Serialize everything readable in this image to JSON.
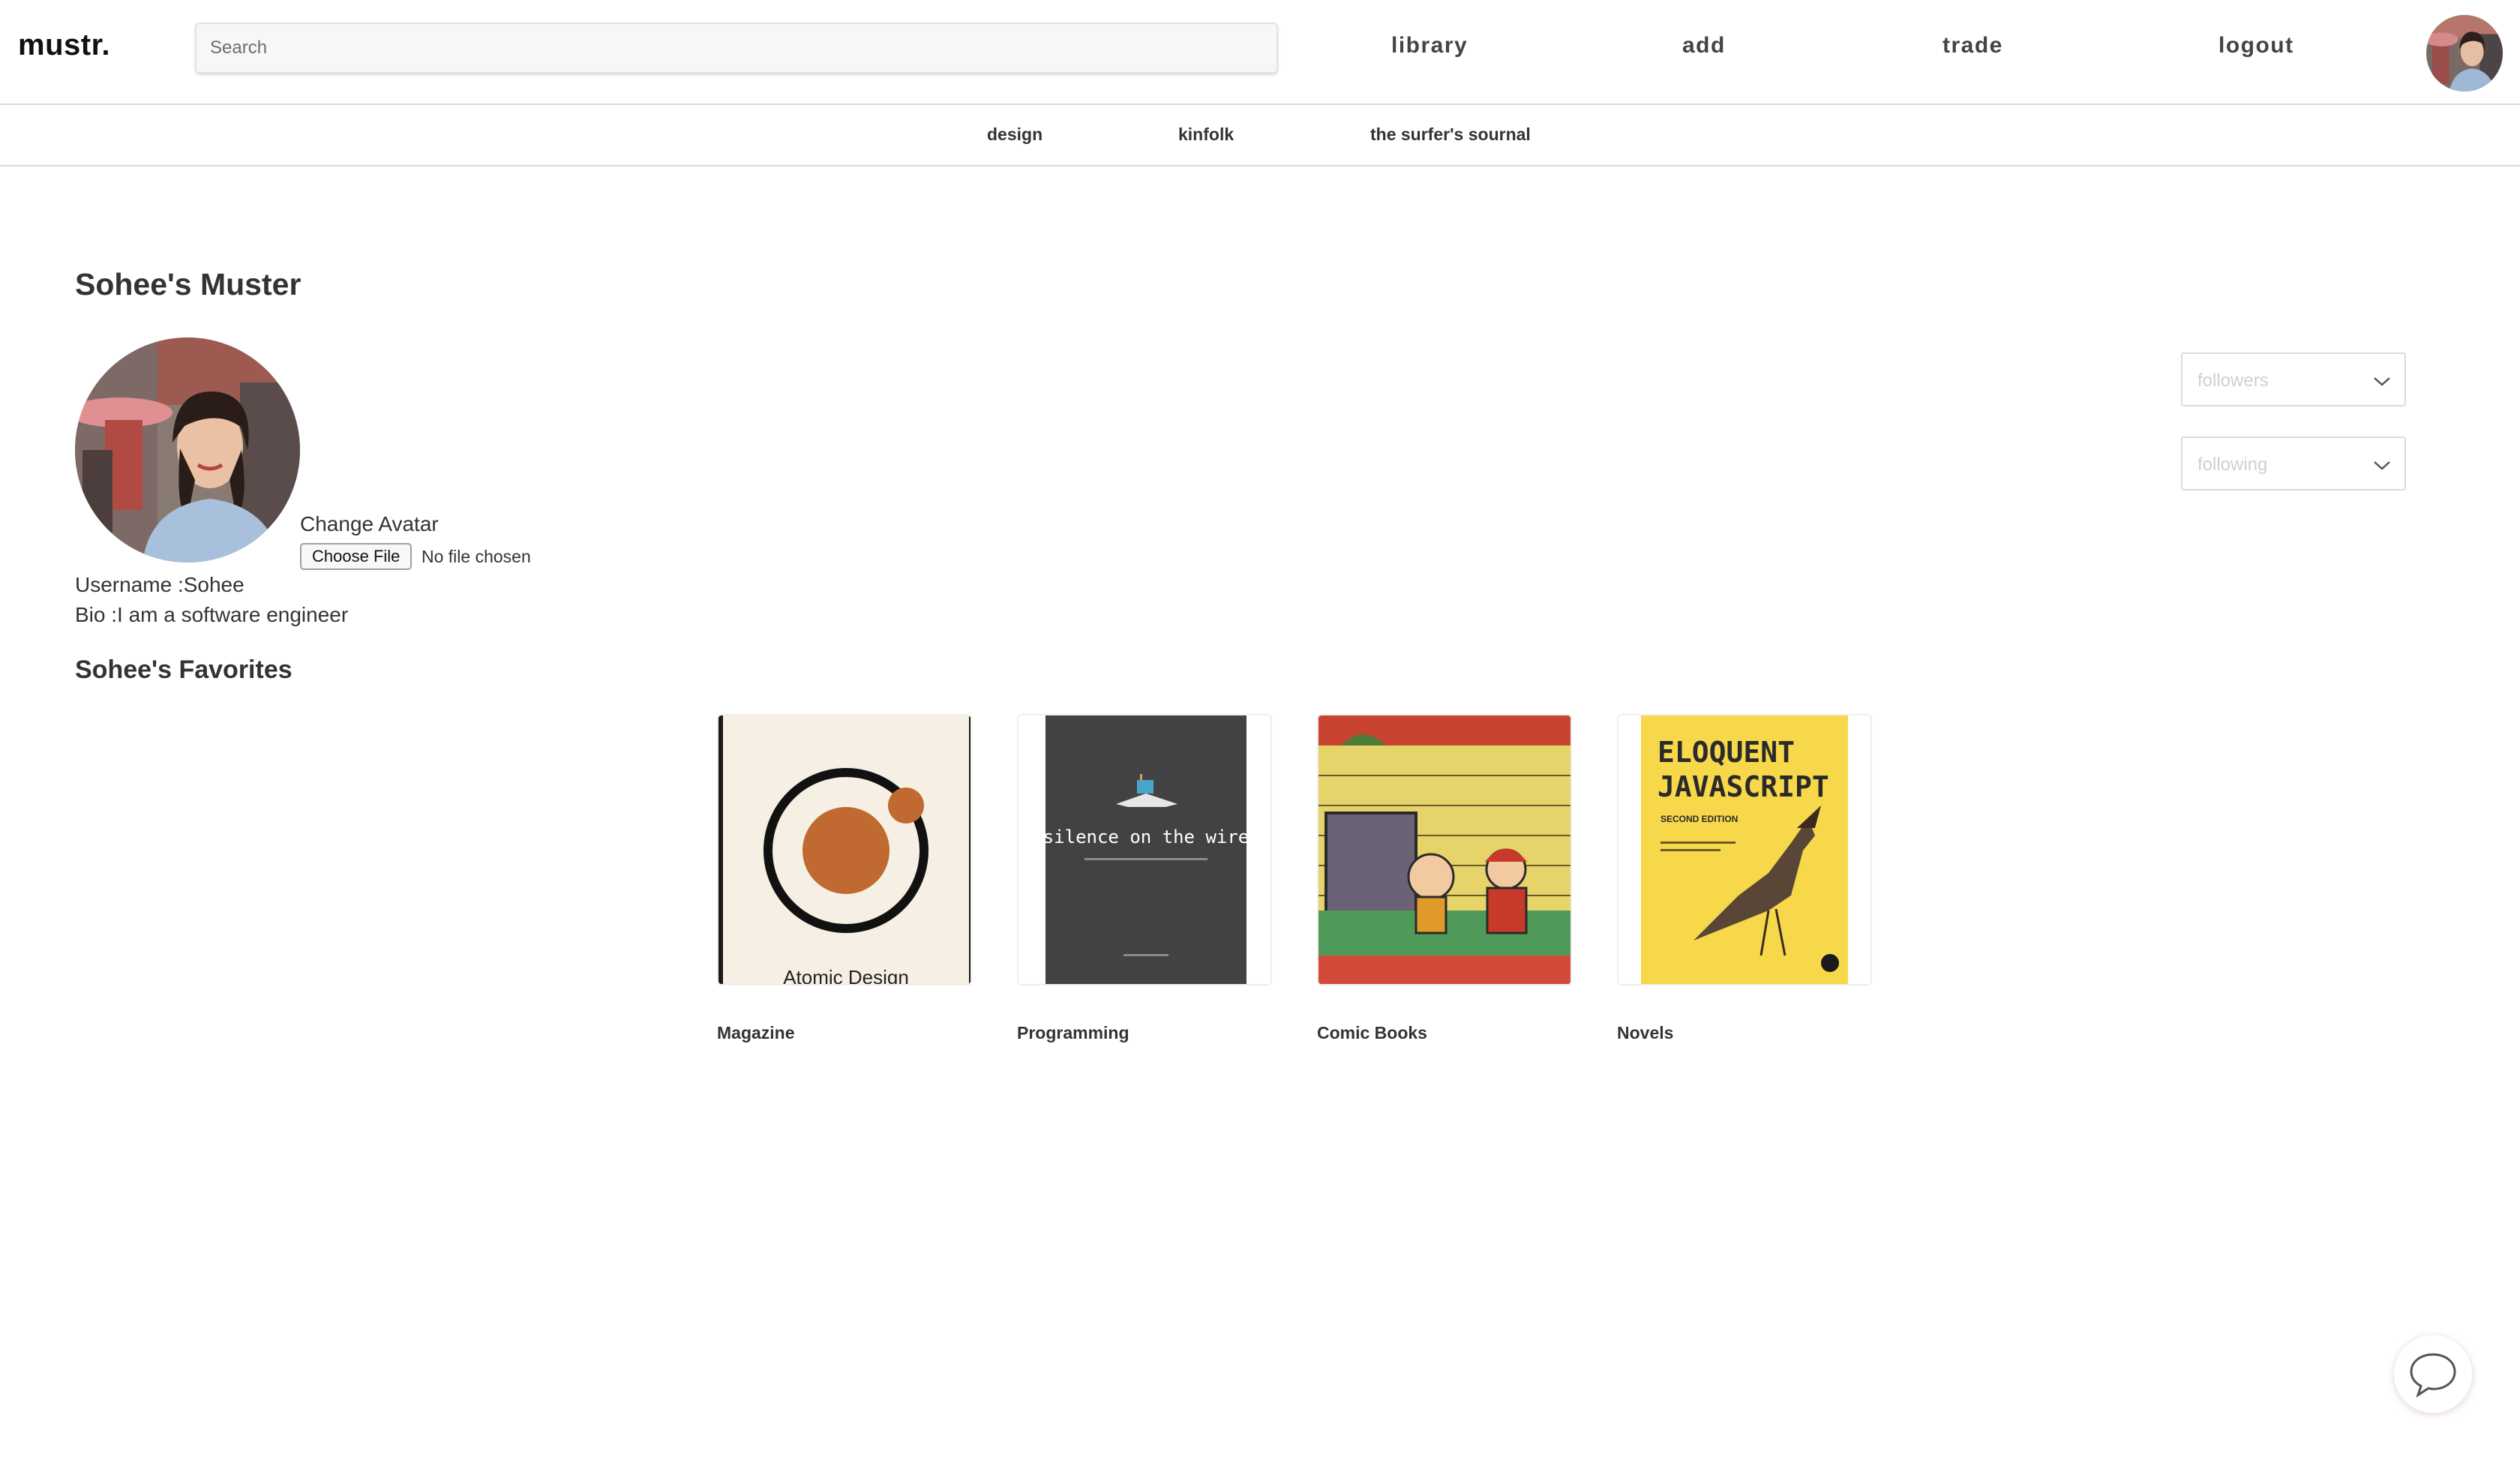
{
  "header": {
    "logo": "mustr.",
    "search": {
      "placeholder": "Search",
      "value": ""
    },
    "nav": {
      "library": "library",
      "add": "add",
      "trade": "trade",
      "logout": "logout"
    }
  },
  "subnav": {
    "items": [
      {
        "label": "design"
      },
      {
        "label": "kinfolk"
      },
      {
        "label": "the surfer's sournal"
      }
    ]
  },
  "profile": {
    "title": "Sohee's Muster",
    "change_avatar_label": "Change Avatar",
    "file_button_label": "Choose File",
    "file_status": "No file chosen",
    "username_line": "Username :Sohee",
    "bio_line": "Bio :I am a software engineer",
    "favorites_title": "Sohee's Favorites"
  },
  "dropdowns": {
    "followers": {
      "selected": "followers"
    },
    "following": {
      "selected": "following"
    }
  },
  "favorites": [
    {
      "label": "Magazine",
      "cover_text": "Atomic Design"
    },
    {
      "label": "Programming",
      "cover_text": "silence on the wire"
    },
    {
      "label": "Comic Books"
    },
    {
      "label": "Novels",
      "cover_title_line1": "ELOQUENT",
      "cover_title_line2": "JAVASCRIPT",
      "cover_edition": "SECOND EDITION"
    }
  ],
  "colors": {
    "text_primary": "#333333",
    "border": "#dcdcdc",
    "atomic_bg": "#f5f0e3",
    "atomic_orange": "#c06a32",
    "silence_bg": "#424245",
    "eloquent_yellow": "#f6d84a"
  },
  "icons": {
    "chat": "speech-bubble-icon",
    "dropdown": "chevron-down-icon"
  }
}
